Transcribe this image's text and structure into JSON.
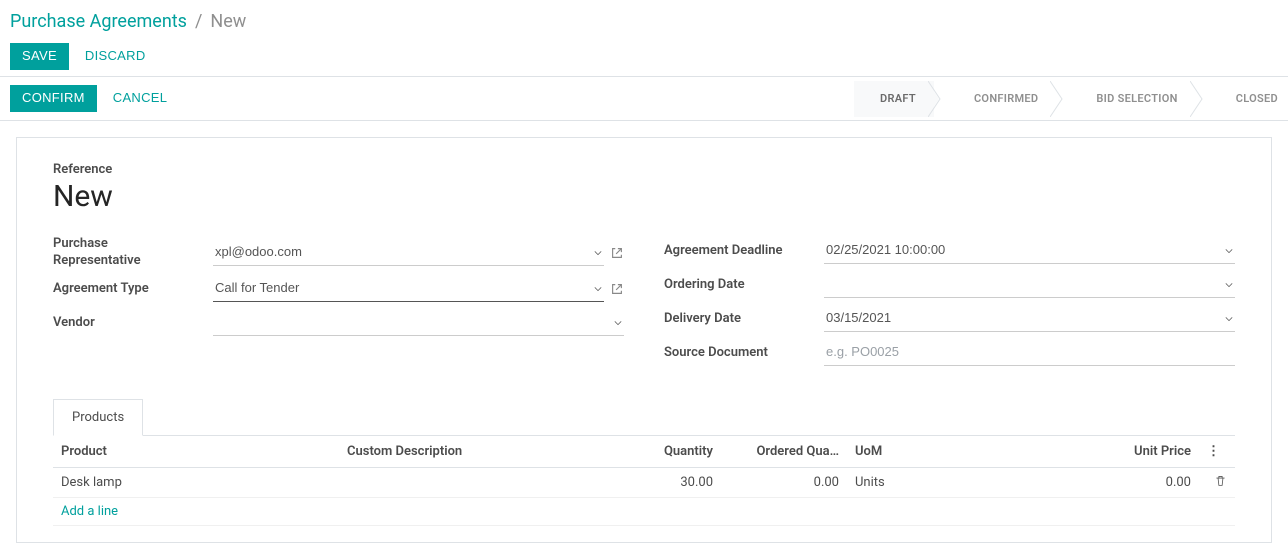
{
  "breadcrumb": {
    "root": "Purchase Agreements",
    "sep": "/",
    "current": "New"
  },
  "buttons": {
    "save": "Save",
    "discard": "Discard",
    "confirm": "Confirm",
    "cancel": "Cancel"
  },
  "stages": [
    "Draft",
    "Confirmed",
    "Bid Selection",
    "Closed"
  ],
  "stage_active_index": 0,
  "form": {
    "reference_label": "Reference",
    "reference_value": "New",
    "left": {
      "purchase_rep_label1": "Purchase",
      "purchase_rep_label2": "Representative",
      "purchase_rep_value": "xpl@odoo.com",
      "agreement_type_label": "Agreement Type",
      "agreement_type_value": "Call for Tender",
      "vendor_label": "Vendor",
      "vendor_value": ""
    },
    "right": {
      "deadline_label": "Agreement Deadline",
      "deadline_value": "02/25/2021 10:00:00",
      "ordering_date_label": "Ordering Date",
      "ordering_date_value": "",
      "delivery_date_label": "Delivery Date",
      "delivery_date_value": "03/15/2021",
      "source_doc_label": "Source Document",
      "source_doc_value": "",
      "source_doc_placeholder": "e.g. PO0025"
    }
  },
  "tabs": [
    "Products"
  ],
  "table": {
    "headers": {
      "product": "Product",
      "desc": "Custom Description",
      "qty": "Quantity",
      "oqty": "Ordered Qua…",
      "uom": "UoM",
      "price": "Unit Price"
    },
    "rows": [
      {
        "product": "Desk lamp",
        "desc": "",
        "qty": "30.00",
        "oqty": "0.00",
        "uom": "Units",
        "price": "0.00"
      }
    ],
    "add_line": "Add a line"
  }
}
